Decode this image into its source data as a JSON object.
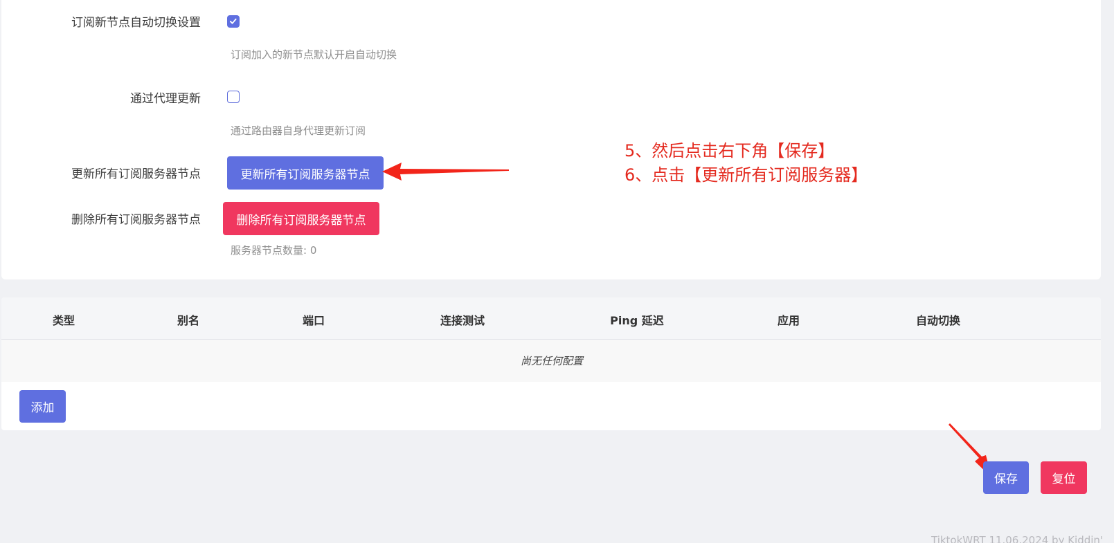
{
  "settings": {
    "auto_switch": {
      "label": "订阅新节点自动切换设置",
      "checked": true,
      "hint": "订阅加入的新节点默认开启自动切换"
    },
    "proxy_update": {
      "label": "通过代理更新",
      "checked": false,
      "hint": "通过路由器自身代理更新订阅"
    },
    "update_all": {
      "label": "更新所有订阅服务器节点",
      "button": "更新所有订阅服务器节点"
    },
    "delete_all": {
      "label": "删除所有订阅服务器节点",
      "button": "删除所有订阅服务器节点",
      "count_text": "服务器节点数量: 0"
    }
  },
  "annotations": {
    "line1": "5、然后点击右下角【保存】",
    "line2": "6、点击【更新所有订阅服务器】",
    "color": "#e42a1f"
  },
  "table": {
    "columns": [
      "类型",
      "别名",
      "端口",
      "连接测试",
      "Ping 延迟",
      "应用",
      "自动切换"
    ],
    "empty_text": "尚无任何配置",
    "add_button": "添加"
  },
  "actions": {
    "save": "保存",
    "reset": "复位"
  },
  "footer": {
    "text": "TiktokWRT 11.06.2024 by Kiddin'"
  },
  "colors": {
    "primary": "#5f6fe0",
    "danger": "#f0375f",
    "background": "#f0f1f4"
  }
}
